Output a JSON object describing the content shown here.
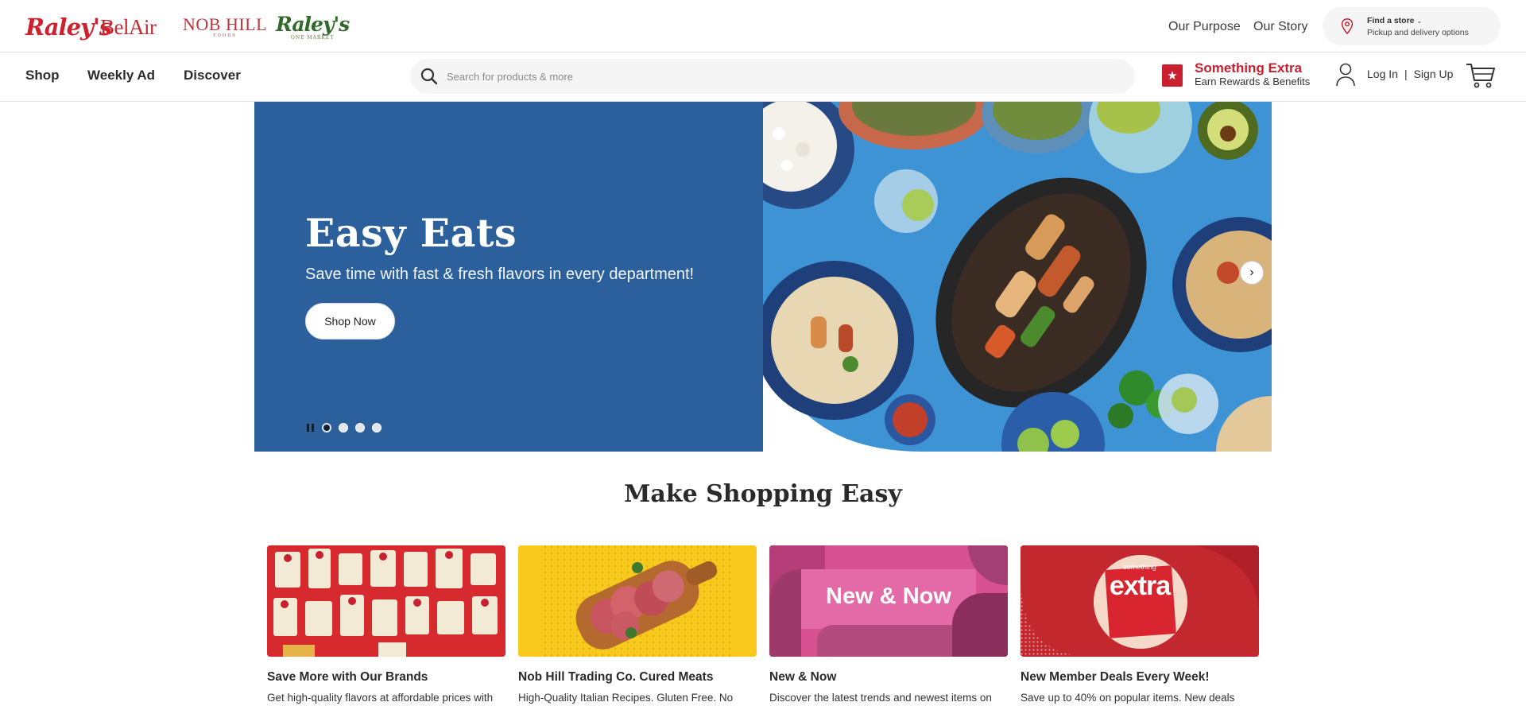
{
  "brands": [
    {
      "name": "Raley's",
      "sub": ""
    },
    {
      "name": "BelAir",
      "sub": ""
    },
    {
      "name": "NOB HILL",
      "sub": "FOODS"
    },
    {
      "name": "Raley's",
      "sub": "ONE MARKET"
    }
  ],
  "top_links": {
    "purpose": "Our Purpose",
    "story": "Our Story"
  },
  "find_store": {
    "title": "Find a store",
    "subtitle": "Pickup and delivery options"
  },
  "nav": {
    "shop": "Shop",
    "weekly_ad": "Weekly Ad",
    "discover": "Discover"
  },
  "search": {
    "placeholder": "Search for products & more"
  },
  "rewards": {
    "title": "Something Extra",
    "subtitle": "Earn Rewards & Benefits"
  },
  "auth": {
    "login": "Log In",
    "separator": "|",
    "signup": "Sign Up"
  },
  "hero": {
    "title": "Easy Eats",
    "subtitle": "Save time with fast & fresh flavors in every department!",
    "button": "Shop Now",
    "slides": 4,
    "active_slide": 1
  },
  "section": {
    "title": "Make Shopping Easy"
  },
  "cards": [
    {
      "title": "Save More with Our Brands",
      "desc": "Get high-quality flavors at affordable prices with"
    },
    {
      "title": "Nob Hill Trading Co. Cured Meats",
      "desc": "High-Quality Italian Recipes. Gluten Free. No"
    },
    {
      "title": "New & Now",
      "desc": "Discover the latest trends and newest items on",
      "image_text": "New & Now"
    },
    {
      "title": "New Member Deals Every Week!",
      "desc": "Save up to 40% on popular items. New deals",
      "image_text_small": "something",
      "image_text_big": "extra"
    }
  ],
  "colors": {
    "brand_red": "#c8202f",
    "hero_blue": "#2c609d",
    "accent_blue": "#3d95d7"
  },
  "icons": [
    "location-pin-icon",
    "chevron-down-icon",
    "search-icon",
    "star-icon",
    "user-icon",
    "cart-icon",
    "pause-icon",
    "chevron-right-icon"
  ]
}
